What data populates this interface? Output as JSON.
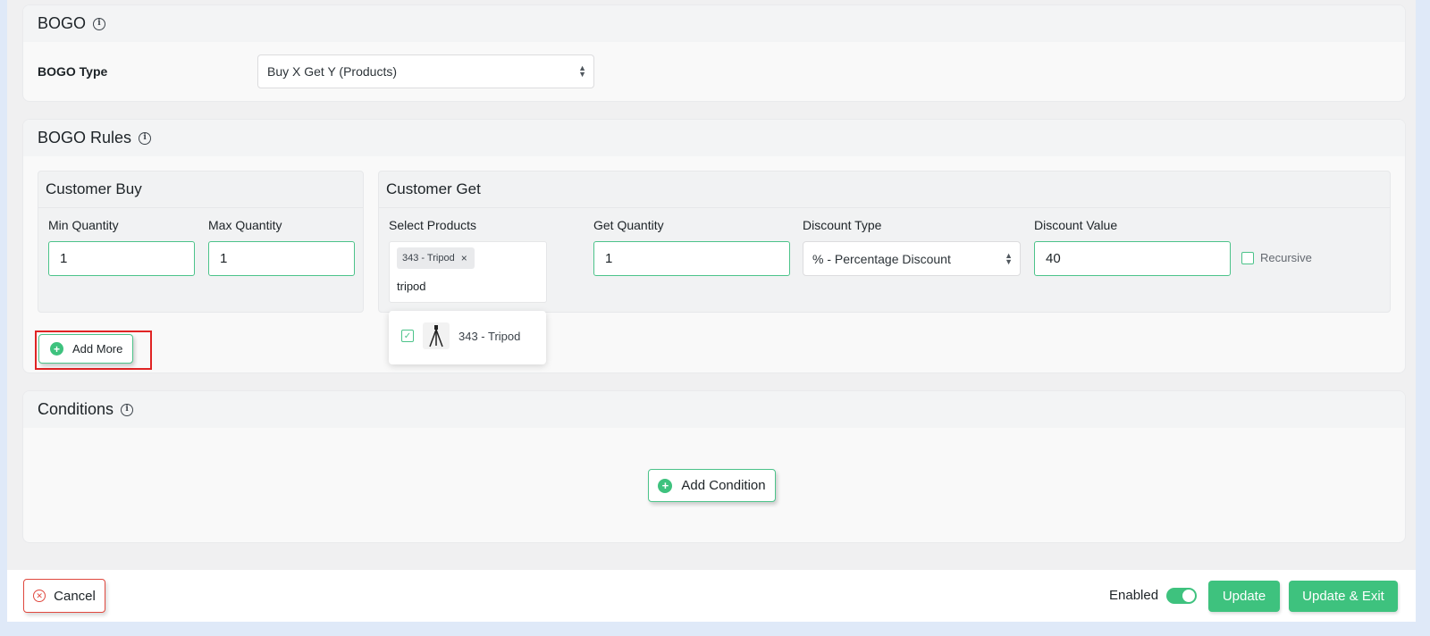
{
  "bogo": {
    "title": "BOGO",
    "type_label": "BOGO Type",
    "type_value": "Buy X Get Y (Products)"
  },
  "rules": {
    "title": "BOGO Rules",
    "customer_buy": {
      "title": "Customer Buy",
      "min_label": "Min Quantity",
      "min_value": "1",
      "max_label": "Max Quantity",
      "max_value": "1"
    },
    "customer_get": {
      "title": "Customer Get",
      "products_label": "Select Products",
      "selected_tag": "343 - Tripod",
      "tag_remove": "×",
      "search_text": "tripod",
      "dropdown_option": "343 - Tripod",
      "quantity_label": "Get Quantity",
      "quantity_value": "1",
      "discount_type_label": "Discount Type",
      "discount_type_value": "% - Percentage Discount",
      "discount_value_label": "Discount Value",
      "discount_value": "40",
      "recursive_label": "Recursive"
    },
    "add_more": "Add More"
  },
  "conditions": {
    "title": "Conditions",
    "add_condition": "Add Condition"
  },
  "footer": {
    "cancel": "Cancel",
    "enabled_label": "Enabled",
    "update": "Update",
    "update_exit": "Update & Exit"
  },
  "colors": {
    "accent": "#3ec27e",
    "cancel": "#e0483e",
    "highlight": "#e02424"
  },
  "icons": {
    "info": "info-icon",
    "add": "plus-circle-icon",
    "cancel": "x-circle-icon",
    "product": "tripod-icon"
  }
}
